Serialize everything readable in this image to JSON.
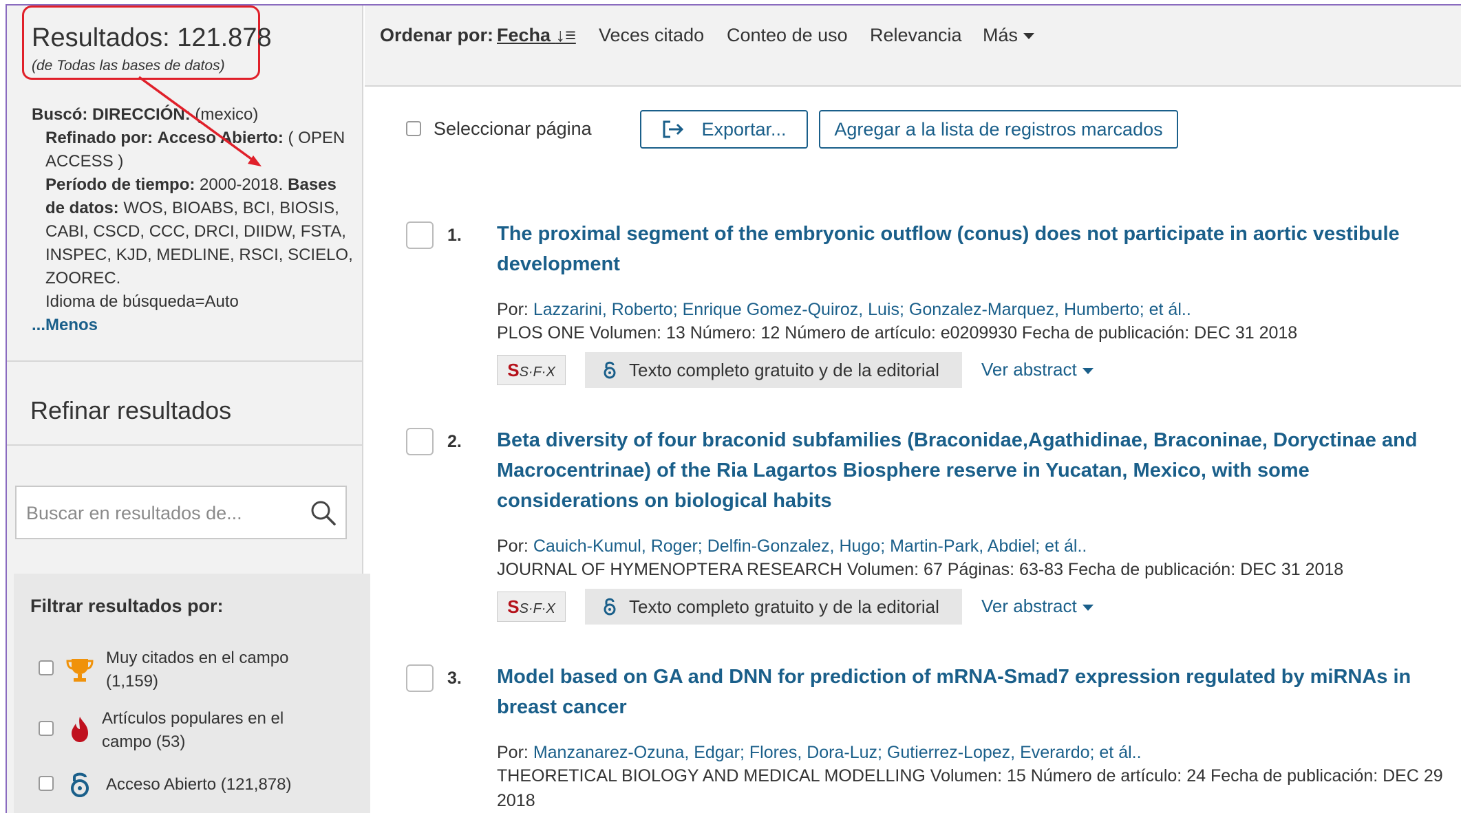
{
  "sidebar": {
    "results_title": "Resultados: 121.878",
    "results_subtitle": "(de Todas las bases de datos)",
    "searched_label": "Buscó:",
    "searched_field": "DIRECCIÓN:",
    "searched_value": "(mexico)",
    "refined_label": "Refinado por:",
    "refined_field": "Acceso Abierto:",
    "refined_value": "( OPEN ACCESS )",
    "period_label": "Período de tiempo:",
    "period_value": "2000-2018.",
    "databases_label": "Bases de datos:",
    "databases_value": "WOS, BIOABS, BCI, BIOSIS, CABI, CSCD, CCC, DRCI, DIIDW, FSTA, INSPEC, KJD, MEDLINE, RSCI, SCIELO, ZOOREC.",
    "language": "Idioma de búsqueda=Auto",
    "less_link": "...Menos",
    "refine_title": "Refinar resultados",
    "search_placeholder": "Buscar en resultados de...",
    "filter_title": "Filtrar resultados por:",
    "filters": [
      {
        "icon": "trophy-icon",
        "label": "Muy citados en el campo (1,159)"
      },
      {
        "icon": "flame-icon",
        "label": "Artículos populares en el campo (53)"
      },
      {
        "icon": "open-access-icon",
        "label": "Acceso Abierto (121,878)"
      }
    ]
  },
  "sortbar": {
    "label": "Ordenar por:",
    "options": [
      "Fecha",
      "Veces citado",
      "Conteo de uso",
      "Relevancia",
      "Más"
    ]
  },
  "toolbar": {
    "select_page": "Seleccionar página",
    "export_label": "Exportar...",
    "marked_list_label": "Agregar a la lista de registros marcados"
  },
  "records": [
    {
      "num": "1.",
      "title": "The proximal segment of the embryonic outflow (conus) does not participate in aortic vestibule development",
      "authors_prefix": "Por:",
      "authors": "Lazzarini, Roberto; Enrique Gomez-Quiroz, Luis; Gonzalez-Marquez, Humberto; et ál..",
      "source": "PLOS ONE  Volumen: 13  Número: 12   Número de artículo: e0209930  Fecha de publicación: DEC 31 2018",
      "sfx": "S·F·X",
      "oa_label": "Texto completo gratuito y de la editorial",
      "abstract_label": "Ver abstract"
    },
    {
      "num": "2.",
      "title": "Beta diversity of four braconid subfamilies (Braconidae,Agathidinae, Braconinae, Doryctinae and Macrocentrinae) of the Ria Lagartos Biosphere reserve in Yucatan, Mexico, with some considerations on biological habits",
      "authors_prefix": "Por:",
      "authors": "Cauich-Kumul, Roger; Delfin-Gonzalez, Hugo; Martin-Park, Abdiel; et ál..",
      "source": "JOURNAL OF HYMENOPTERA RESEARCH  Volumen: 67  Páginas: 63-83  Fecha de publicación: DEC 31 2018",
      "sfx": "S·F·X",
      "oa_label": "Texto completo gratuito y de la editorial",
      "abstract_label": "Ver abstract"
    },
    {
      "num": "3.",
      "title": "Model based on GA and DNN for prediction of mRNA-Smad7 expression regulated by miRNAs in breast cancer",
      "authors_prefix": "Por:",
      "authors": "Manzanarez-Ozuna, Edgar; Flores, Dora-Luz; Gutierrez-Lopez, Everardo; et ál..",
      "source": "THEORETICAL BIOLOGY AND MEDICAL MODELLING  Volumen: 15   Número de artículo: 24  Fecha de publicación: DEC 29 2018"
    }
  ],
  "colors": {
    "link": "#1a5f8a",
    "highlight_box": "#e0202a",
    "frame": "#8a6bbf"
  }
}
